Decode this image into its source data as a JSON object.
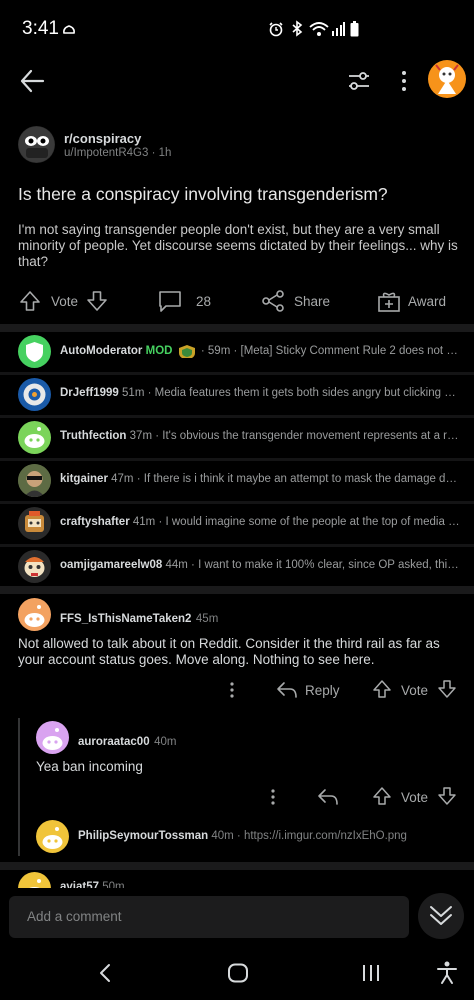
{
  "status": {
    "time": "3:41"
  },
  "post": {
    "subreddit": "r/conspiracy",
    "author": "u/ImpotentR4G3",
    "age": "1h",
    "title": "Is there a conspiracy involving transgenderism?",
    "body": "I'm not saying transgender people don't exist, but they are a very small minority of people. Yet discourse seems dictated by their feelings... why is that?",
    "actions": {
      "vote": "Vote",
      "comments": "28",
      "share": "Share",
      "award": "Award"
    }
  },
  "previews": [
    {
      "user": "AutoModerator",
      "badge": "MOD",
      "time": "59m",
      "text": "[Meta] Sticky Comment Rule 2 does not a...",
      "color": "#46d160"
    },
    {
      "user": "DrJeff1999",
      "time": "51m",
      "text": "Media features them it gets both sides angry but clicking or...",
      "color": "#1a5aa8"
    },
    {
      "user": "Truthfection",
      "time": "37m",
      "text": "It's obvious the transgender movement represents at a rud...",
      "color": "#7bd45a"
    },
    {
      "user": "kitgainer",
      "time": "47m",
      "text": "If there is i think it maybe an attempt to mask the damage don...",
      "color": "#4a5a3a"
    },
    {
      "user": "craftyshafter",
      "time": "41m",
      "text": "I would imagine some of the people at the top of media co...",
      "color": "#c98a3a"
    },
    {
      "user": "oamjigamareelw08",
      "time": "44m",
      "text": "I want to make it 100% clear, since OP asked, this is ...",
      "color": "#e07030"
    }
  ],
  "comments": {
    "c1": {
      "user": "FFS_IsThisNameTaken2",
      "time": "45m",
      "body": "Not allowed to talk about it on Reddit. Consider it the third rail as far as your account status goes. Move along. Nothing to see here.",
      "reply": "Reply",
      "vote": "Vote"
    },
    "c2": {
      "user": "auroraatac00",
      "time": "40m",
      "body": "Yea ban incoming",
      "vote": "Vote"
    },
    "c3": {
      "user": "PhilipSeymourTossman",
      "time": "40m",
      "link": "https://i.imgur.com/nzIxEhO.png"
    },
    "c4": {
      "user": "aviat57",
      "time": "50m"
    }
  },
  "composer": {
    "placeholder": "Add a comment"
  }
}
